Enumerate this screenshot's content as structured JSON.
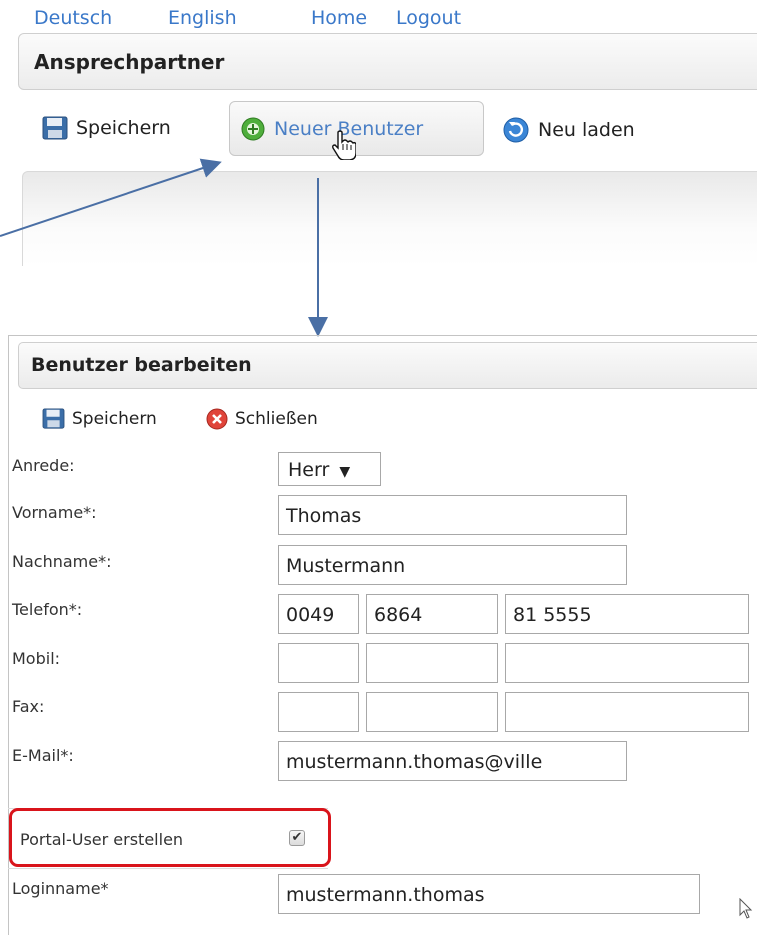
{
  "nav": {
    "links": [
      "Deutsch",
      "English",
      "Home",
      "Logout"
    ]
  },
  "panel1": {
    "title": "Ansprechpartner",
    "toolbar": {
      "save_label": "Speichern",
      "new_user_label": "Neuer Benutzer",
      "reload_label": "Neu laden"
    }
  },
  "panel2": {
    "title": "Benutzer bearbeiten",
    "toolbar": {
      "save_label": "Speichern",
      "close_label": "Schließen"
    }
  },
  "form": {
    "anrede_label": "Anrede:",
    "anrede_value": "Herr",
    "vorname_label": "Vorname*:",
    "vorname_value": "Thomas",
    "nachname_label": "Nachname*:",
    "nachname_value": "Mustermann",
    "telefon_label": "Telefon*:",
    "telefon_country": "0049",
    "telefon_area": "6864",
    "telefon_number": "81 5555",
    "mobil_label": "Mobil:",
    "mobil_country": "",
    "mobil_area": "",
    "mobil_number": "",
    "fax_label": "Fax:",
    "fax_country": "",
    "fax_area": "",
    "fax_number": "",
    "email_label": "E-Mail*:",
    "email_value": "mustermann.thomas@ville",
    "portal_user_label": "Portal-User erstellen",
    "portal_user_checked": true,
    "loginname_label": "Loginname*",
    "loginname_value": "mustermann.thomas"
  },
  "colors": {
    "link": "#3a78c9",
    "highlight": "#d9141b",
    "annotation_arrow": "#4a6fa5"
  },
  "icons": [
    "floppy-save-icon",
    "green-plus-icon",
    "blue-refresh-icon",
    "red-close-icon",
    "hand-cursor-icon",
    "arrow-cursor-icon",
    "select-arrow-icon",
    "checkmark-icon"
  ]
}
